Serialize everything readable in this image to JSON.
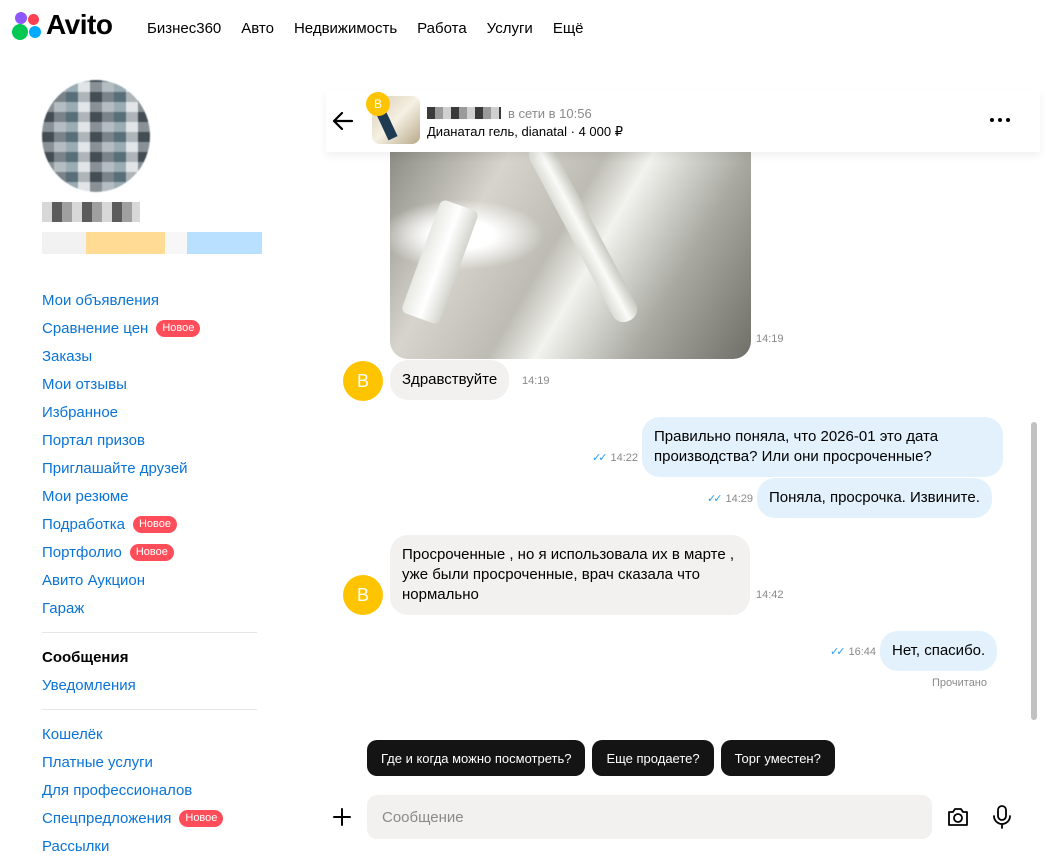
{
  "brand": {
    "name": "Avito"
  },
  "nav": {
    "items": [
      "Бизнес360",
      "Авто",
      "Недвижимость",
      "Работа",
      "Услуги",
      "Ещё"
    ]
  },
  "sidebar": {
    "menu": [
      {
        "label": "Мои объявления",
        "badge": ""
      },
      {
        "label": "Сравнение цен",
        "badge": "Новое"
      },
      {
        "label": "Заказы",
        "badge": ""
      },
      {
        "label": "Мои отзывы",
        "badge": ""
      },
      {
        "label": "Избранное",
        "badge": ""
      },
      {
        "label": "Портал призов",
        "badge": ""
      },
      {
        "label": "Приглашайте друзей",
        "badge": ""
      },
      {
        "label": "Мои резюме",
        "badge": ""
      },
      {
        "label": "Подработка",
        "badge": "Новое"
      },
      {
        "label": "Портфолио",
        "badge": "Новое"
      },
      {
        "label": "Авито Аукцион",
        "badge": ""
      },
      {
        "label": "Гараж",
        "badge": ""
      }
    ],
    "menu2": [
      {
        "label": "Сообщения",
        "active": true
      },
      {
        "label": "Уведомления",
        "active": false
      }
    ],
    "menu3": [
      {
        "label": "Кошелёк",
        "badge": ""
      },
      {
        "label": "Платные услуги",
        "badge": ""
      },
      {
        "label": "Для профессионалов",
        "badge": ""
      },
      {
        "label": "Спецпредложения",
        "badge": "Новое"
      },
      {
        "label": "Рассылки",
        "badge": ""
      }
    ]
  },
  "chat": {
    "header": {
      "avatar_letter": "В",
      "status": "в сети в 10:56",
      "item": "Дианатал гель, dianatal · 4 000 ₽"
    },
    "photo_time": "14:19",
    "messages": {
      "m1": {
        "text": "Здравствуйте",
        "time": "14:19",
        "avatar": "В"
      },
      "m2": {
        "text": "Правильно поняла, что 2026-01 это дата производства? Или они просроченные?",
        "time": "14:22"
      },
      "m3": {
        "text": "Поняла, просрочка. Извините.",
        "time": "14:29"
      },
      "m4": {
        "text": "Просроченные , но я использовала их в марте , уже были просроченные, врач сказала что нормально",
        "time": "14:42",
        "avatar": "В"
      },
      "m5": {
        "text": "Нет, спасибо.",
        "time": "16:44"
      }
    },
    "read_label": "Прочитано",
    "quick_replies": [
      "Где и когда можно посмотреть?",
      "Еще продаете?",
      "Торг уместен?"
    ],
    "composer": {
      "placeholder": "Сообщение",
      "value": ""
    }
  },
  "colors": {
    "link": "#0a74d6",
    "badge": "#ff4d5a",
    "avatar": "#ffc400",
    "outgoing": "#e2f1fc",
    "incoming": "#f2f1f0"
  }
}
